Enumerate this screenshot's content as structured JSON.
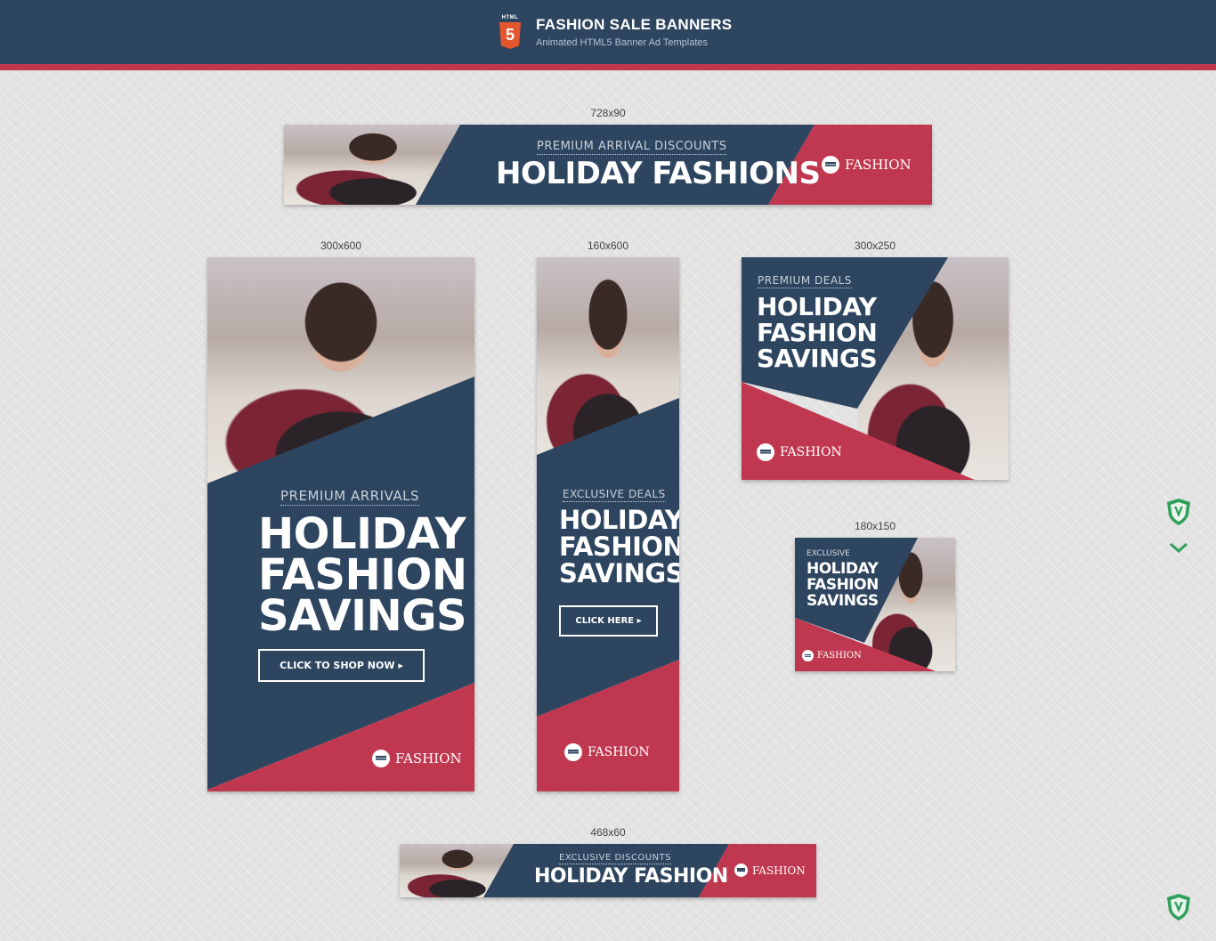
{
  "header": {
    "badge_label": "HTML",
    "badge_number": "5",
    "title": "FASHION SALE BANNERS",
    "subtitle": "Animated HTML5 Banner Ad Templates"
  },
  "colors": {
    "navy": "#2e4560",
    "red": "#c0384f",
    "background": "#e3e3e3"
  },
  "banners": {
    "b728": {
      "size": "728x90",
      "pre": "PREMIUM ARRIVAL DISCOUNTS",
      "headline": "HOLIDAY FASHIONS",
      "logo": "FASHION"
    },
    "b300x600": {
      "size": "300x600",
      "pre": "PREMIUM ARRIVALS",
      "line1": "HOLIDAY",
      "line2": "FASHION",
      "line3": "SAVINGS",
      "cta": "CLICK TO SHOP NOW ▸",
      "logo": "FASHION"
    },
    "b160": {
      "size": "160x600",
      "pre": "EXCLUSIVE DEALS",
      "line1": "HOLIDAY",
      "line2": "FASHION",
      "line3": "SAVINGS",
      "cta": "CLICK HERE ▸",
      "logo": "FASHION"
    },
    "b300x250": {
      "size": "300x250",
      "pre": "PREMIUM DEALS",
      "line1": "HOLIDAY",
      "line2": "FASHION",
      "line3": "SAVINGS",
      "logo": "FASHION"
    },
    "b180": {
      "size": "180x150",
      "pre": "EXCLUSIVE",
      "line1": "HOLIDAY",
      "line2": "FASHION",
      "line3": "SAVINGS",
      "logo": "FASHION"
    },
    "b468": {
      "size": "468x60",
      "pre": "EXCLUSIVE DISCOUNTS",
      "headline": "HOLIDAY FASHION",
      "logo": "FASHION"
    }
  },
  "icons": [
    "html5-icon",
    "shield-icon",
    "chevron-down-icon",
    "fashion-logo-icon"
  ]
}
